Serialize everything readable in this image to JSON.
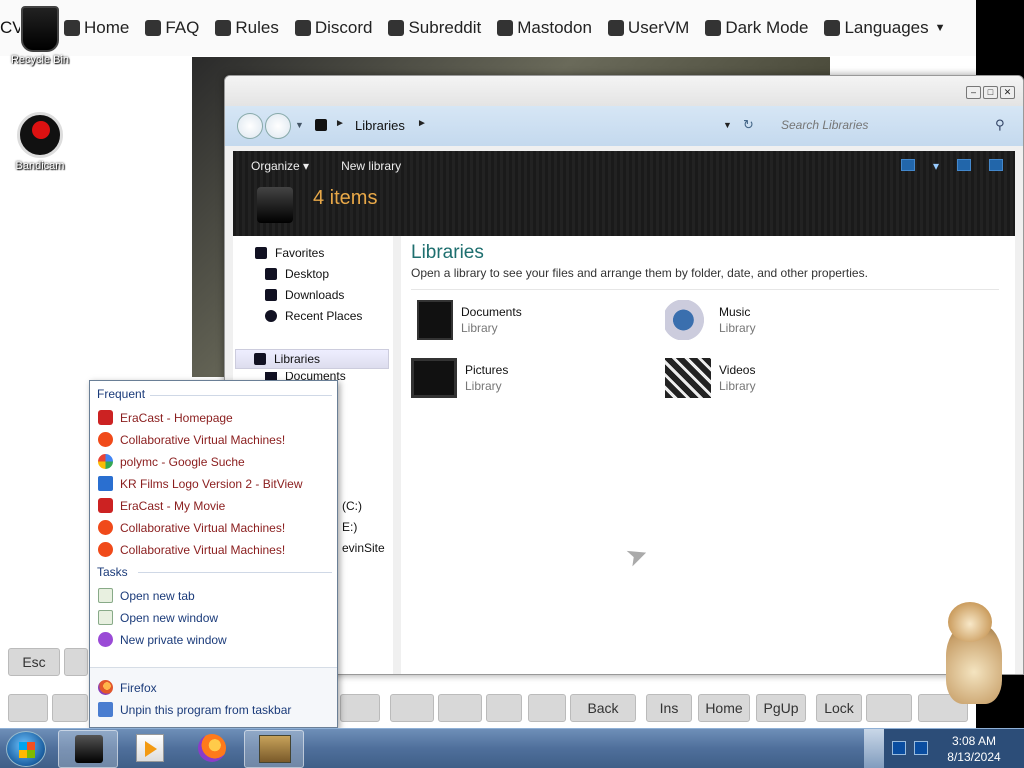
{
  "topnav": {
    "brand": "CV",
    "items": [
      {
        "label": "Home",
        "icon": "home-icon"
      },
      {
        "label": "FAQ",
        "icon": "question-icon"
      },
      {
        "label": "Rules",
        "icon": "clipboard-icon"
      },
      {
        "label": "Discord",
        "icon": "discord-icon"
      },
      {
        "label": "Subreddit",
        "icon": "reddit-icon"
      },
      {
        "label": "Mastodon",
        "icon": "mastodon-icon"
      },
      {
        "label": "UserVM",
        "icon": "user-icon"
      },
      {
        "label": "Dark Mode",
        "icon": "gear-icon"
      },
      {
        "label": "Languages",
        "icon": "android-icon"
      }
    ]
  },
  "desktop": {
    "recycle_bin": "Recycle Bin",
    "bandicam": "Bandicam"
  },
  "explorer": {
    "address": "Libraries",
    "search_placeholder": "Search Libraries",
    "toolbar": {
      "organize": "Organize",
      "new_library": "New library"
    },
    "items_count": "4 items",
    "nav": {
      "favorites": "Favorites",
      "desktop": "Desktop",
      "downloads": "Downloads",
      "recent_places": "Recent Places",
      "libraries": "Libraries",
      "documents": "Documents",
      "drive_c": "(C:)",
      "drive_e": "E:)",
      "evinsite": "evinSite"
    },
    "content": {
      "title": "Libraries",
      "description": "Open a library to see your files and arrange them by folder, date, and other properties.",
      "libraries": [
        {
          "name": "Documents",
          "type": "Library"
        },
        {
          "name": "Music",
          "type": "Library"
        },
        {
          "name": "Pictures",
          "type": "Library"
        },
        {
          "name": "Videos",
          "type": "Library"
        }
      ]
    }
  },
  "keyboard": {
    "keys": [
      "Esc",
      "Back",
      "Ins",
      "Home",
      "PgUp",
      "Lock"
    ]
  },
  "jumplist": {
    "frequent_header": "Frequent",
    "frequent": [
      {
        "label": "EraCast - Homepage",
        "icon": "youtube-icon"
      },
      {
        "label": "Collaborative Virtual Machines!",
        "icon": "reddit-icon"
      },
      {
        "label": "polymc - Google Suche",
        "icon": "google-icon"
      },
      {
        "label": "KR Films Logo Version 2 - BitView",
        "icon": "bitview-icon"
      },
      {
        "label": "EraCast - My Movie",
        "icon": "youtube-icon"
      },
      {
        "label": "Collaborative Virtual Machines!",
        "icon": "reddit-icon"
      },
      {
        "label": "Collaborative Virtual Machines!",
        "icon": "reddit-icon"
      }
    ],
    "tasks_header": "Tasks",
    "tasks": [
      {
        "label": "Open new tab",
        "icon": "new-tab-icon"
      },
      {
        "label": "Open new window",
        "icon": "new-window-icon"
      },
      {
        "label": "New private window",
        "icon": "private-mask-icon"
      }
    ],
    "program": "Firefox",
    "unpin": "Unpin this program from taskbar"
  },
  "taskbar": {
    "time": "3:08 AM",
    "date": "8/13/2024"
  }
}
